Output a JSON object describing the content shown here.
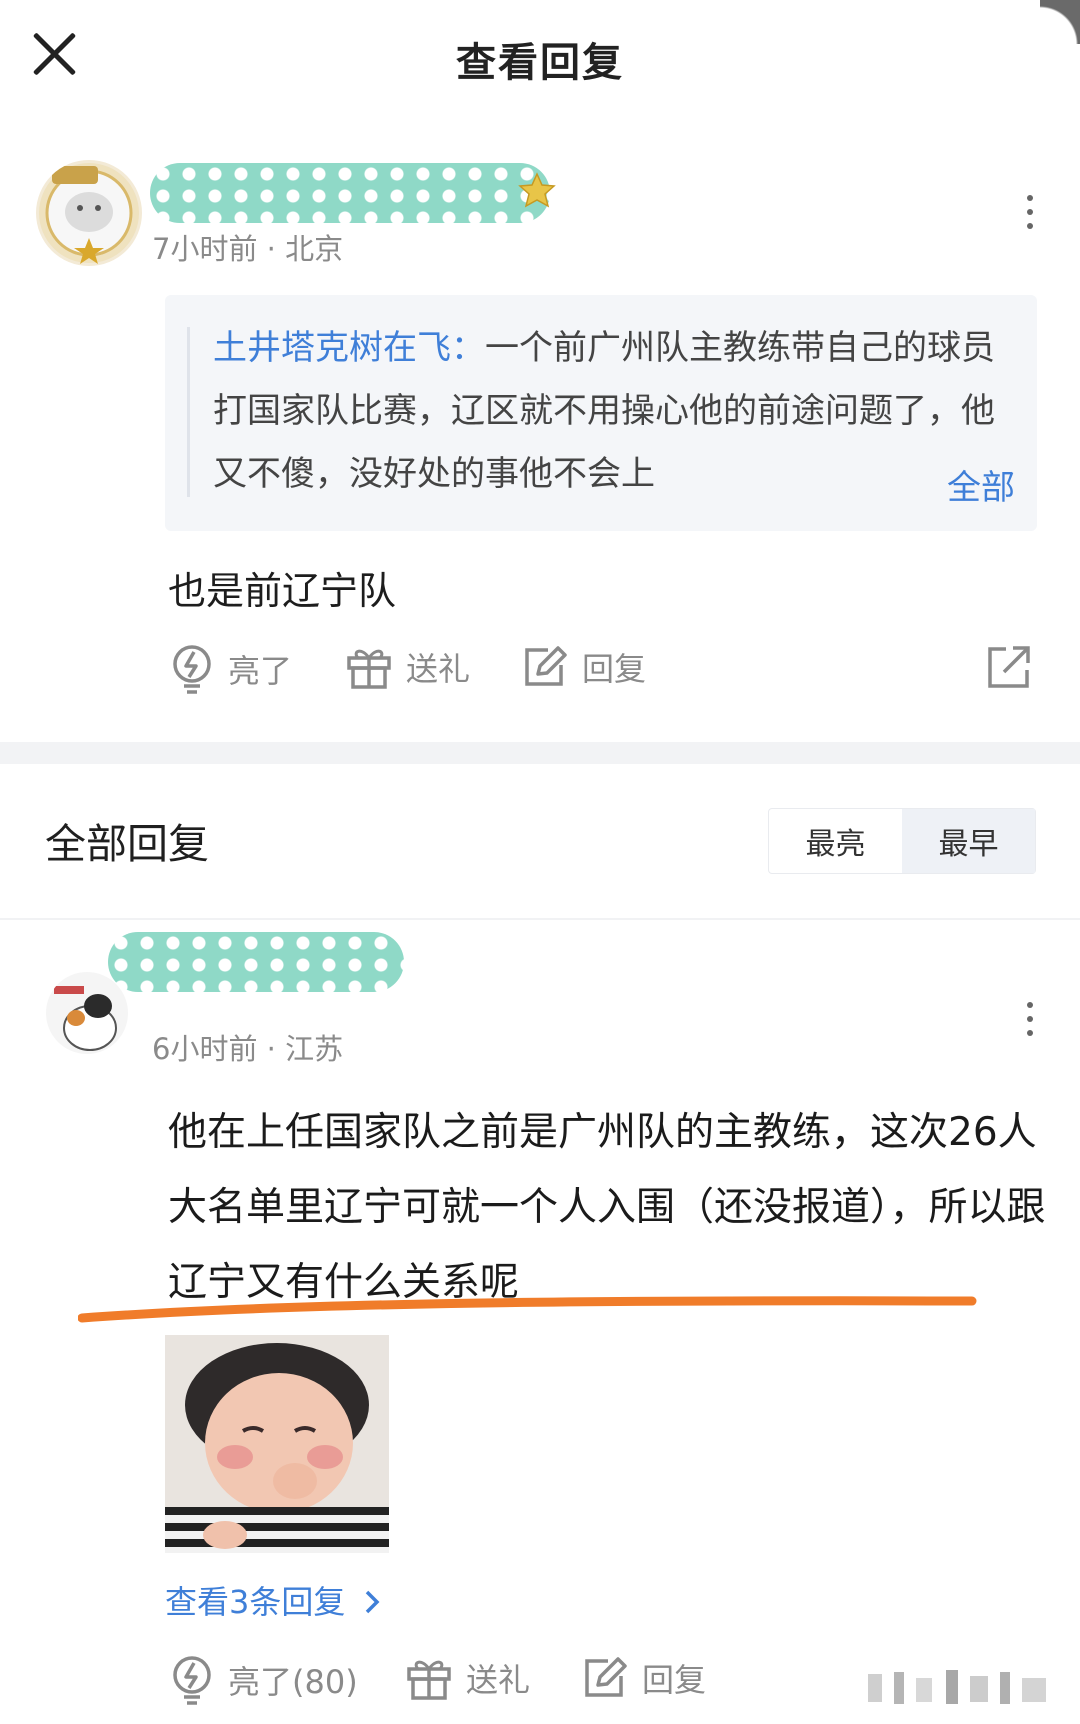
{
  "header": {
    "title": "查看回复"
  },
  "parent_comment": {
    "time": "7小时前",
    "location": "北京",
    "quote": {
      "author": "土井塔克树在飞：",
      "text": "一个前广州队主教练带自己的球员打国家队比赛，辽区就不用操心他的前途问题了，他又不傻，没好处的事他不会上",
      "more_label": "全部"
    },
    "content": "也是前辽宁队",
    "actions": {
      "like": "亮了",
      "gift": "送礼",
      "reply": "回复"
    }
  },
  "replies_section": {
    "title": "全部回复",
    "sort_options": [
      "最亮",
      "最早"
    ],
    "active_sort": "最早"
  },
  "reply": {
    "time": "6小时前",
    "location": "江苏",
    "content": "他在上任国家队之前是广州队的主教练，这次26人大名单里辽宁可就一个人入围（还没报道），所以跟辽宁又有什么关系呢",
    "view_replies": "查看3条回复",
    "actions": {
      "like": "亮了(80)",
      "gift": "送礼",
      "reply": "回复"
    }
  },
  "colors": {
    "accent_blue": "#3f7fd8",
    "mask_teal": "#8fd9c7",
    "underline_orange": "#f07c2a",
    "divider": "#f2f3f5"
  },
  "icons": [
    "close-icon",
    "more-icon",
    "lightbulb-icon",
    "gift-icon",
    "edit-icon",
    "share-icon",
    "chevron-right-icon"
  ]
}
